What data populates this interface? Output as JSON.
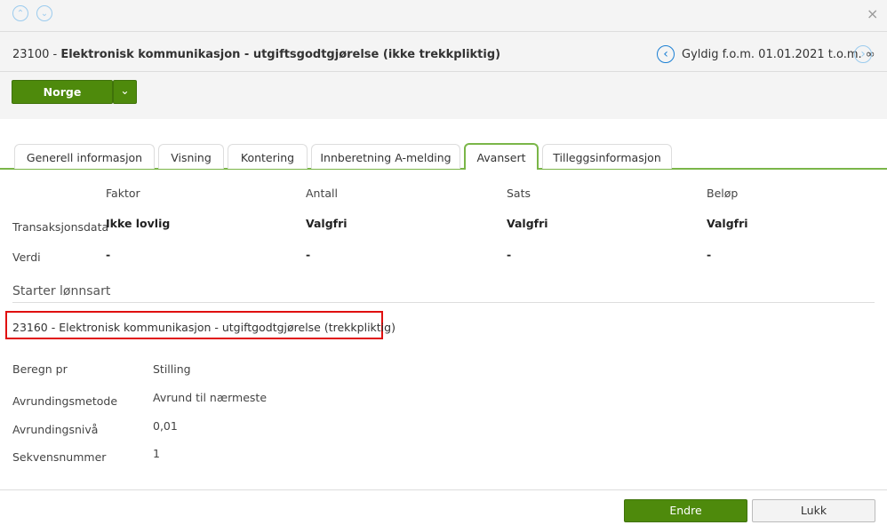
{
  "header": {
    "code": "23100",
    "separator": " - ",
    "title": "Elektronisk kommunikasjon - utgiftsgodtgjørelse (ikke trekkpliktig)",
    "validity": "Gyldig f.o.m. 01.01.2021 t.o.m. ∞"
  },
  "country_button": {
    "label": "Norge"
  },
  "tabs": [
    "Generell informasjon",
    "Visning",
    "Kontering",
    "Innberetning A-melding",
    "Avansert",
    "Tilleggsinformasjon"
  ],
  "grid": {
    "columns": [
      "Faktor",
      "Antall",
      "Sats",
      "Beløp"
    ],
    "rows": [
      {
        "label": "Transaksjonsdata",
        "values": [
          "Ikke lovlig",
          "Valgfri",
          "Valgfri",
          "Valgfri"
        ]
      },
      {
        "label": "Verdi",
        "values": [
          "-",
          "-",
          "-",
          "-"
        ]
      }
    ]
  },
  "starter": {
    "heading": "Starter lønnsart",
    "item": "23160 - Elektronisk kommunikasjon - utgiftgodtgjørelse (trekkpliktig)"
  },
  "props": [
    {
      "label": "Beregn pr",
      "value": "Stilling"
    },
    {
      "label": "Avrundingsmetode",
      "value": "Avrund til nærmeste"
    },
    {
      "label": "Avrundingsnivå",
      "value": "0,01"
    },
    {
      "label": "Sekvensnummer",
      "value": "1"
    }
  ],
  "footer": {
    "edit": "Endre",
    "close": "Lukk"
  },
  "icons": {
    "up": "⌃",
    "down": "⌄",
    "close": "×",
    "prev": "‹",
    "next": "›",
    "caret": "⌄"
  }
}
